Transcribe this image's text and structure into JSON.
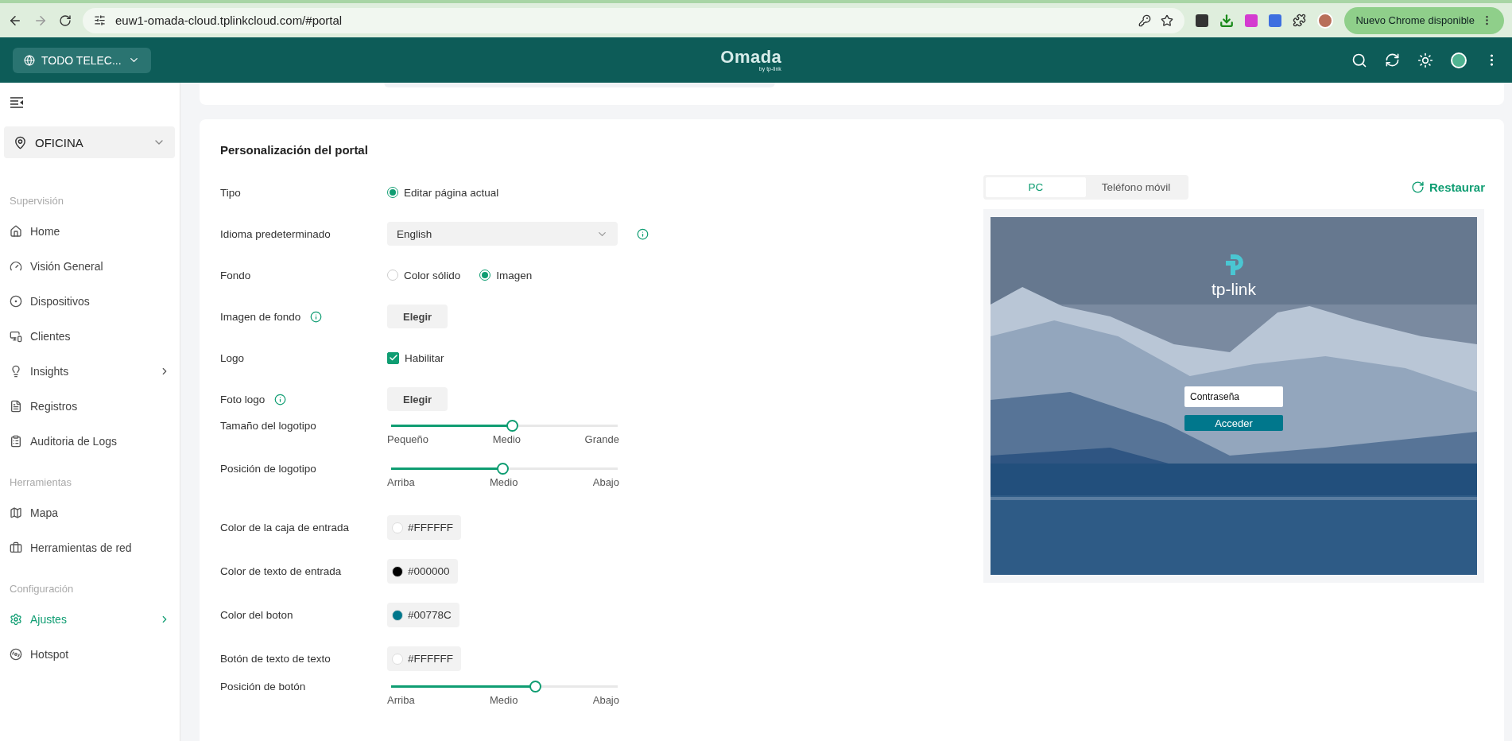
{
  "browser": {
    "url": "euw1-omada-cloud.tplinkcloud.com/#portal",
    "update_button": "Nuevo Chrome disponible"
  },
  "header": {
    "site_selector": "TODO TELEC...",
    "logo": "Omada",
    "logo_sub": "by tp-link"
  },
  "sidebar": {
    "site": "OFICINA",
    "sections": [
      {
        "title": "Supervisión",
        "items": [
          {
            "label": "Home",
            "selected": false,
            "arrow": false
          },
          {
            "label": "Visión General",
            "selected": false,
            "arrow": false
          },
          {
            "label": "Dispositivos",
            "selected": false,
            "arrow": false
          },
          {
            "label": "Clientes",
            "selected": false,
            "arrow": false
          },
          {
            "label": "Insights",
            "selected": false,
            "arrow": true
          },
          {
            "label": "Registros",
            "selected": false,
            "arrow": false
          },
          {
            "label": "Auditoria de Logs",
            "selected": false,
            "arrow": false
          }
        ]
      },
      {
        "title": "Herramientas",
        "items": [
          {
            "label": "Mapa",
            "selected": false,
            "arrow": false
          },
          {
            "label": "Herramientas de red",
            "selected": false,
            "arrow": false
          }
        ]
      },
      {
        "title": "Configuración",
        "items": [
          {
            "label": "Ajustes",
            "selected": true,
            "arrow": true
          },
          {
            "label": "Hotspot",
            "selected": false,
            "arrow": false
          }
        ]
      }
    ]
  },
  "portal": {
    "title": "Personalización del portal",
    "rows": [
      {
        "label": "Tipo",
        "kind": "radio",
        "options": [
          {
            "label": "Editar página actual",
            "selected": true
          }
        ]
      },
      {
        "label": "Idioma predeterminado",
        "kind": "select",
        "value": "English",
        "info_icon": true
      },
      {
        "label": "Fondo",
        "kind": "radio",
        "options": [
          {
            "label": "Color sólido",
            "selected": false
          },
          {
            "label": "Imagen",
            "selected": true
          }
        ]
      },
      {
        "label": "Imagen de fondo",
        "kind": "button",
        "button": "Elegir",
        "info_icon": true
      },
      {
        "label": "Logo",
        "kind": "checkbox",
        "option": "Habilitar",
        "checked": true
      },
      {
        "label": "Foto logo",
        "kind": "button",
        "button": "Elegir",
        "info_icon": true
      },
      {
        "label": "Tamaño del logotipo",
        "kind": "slider",
        "level": 0.54,
        "ticks": [
          "Pequeño",
          "Medio",
          "Grande"
        ]
      },
      {
        "label": "Posición de logotipo",
        "kind": "slider",
        "level": 0.5,
        "ticks": [
          "Arriba",
          "Medio",
          "Abajo"
        ]
      },
      {
        "label": "Color de la caja de entrada",
        "kind": "color",
        "value": "#FFFFFF",
        "color": "#ffffff"
      },
      {
        "label": "Color de texto de entrada",
        "kind": "color",
        "value": "#000000",
        "color": "#000000"
      },
      {
        "label": "Color del boton",
        "kind": "color",
        "value": "#00778C",
        "color": "#00778c"
      },
      {
        "label": "Botón de texto de texto",
        "kind": "color",
        "value": "#FFFFFF",
        "color": "#ffffff"
      },
      {
        "label": "Posición de botón",
        "kind": "slider",
        "level": 0.64,
        "ticks": [
          "Arriba",
          "Medio",
          "Abajo"
        ]
      }
    ]
  },
  "preview": {
    "tabs": [
      {
        "label": "PC",
        "selected": true
      },
      {
        "label": "Teléfono móvil",
        "selected": false
      }
    ],
    "restore": "Restaurar",
    "brand": "tp-link",
    "password_placeholder": "Contraseña",
    "login_button": "Acceder"
  }
}
